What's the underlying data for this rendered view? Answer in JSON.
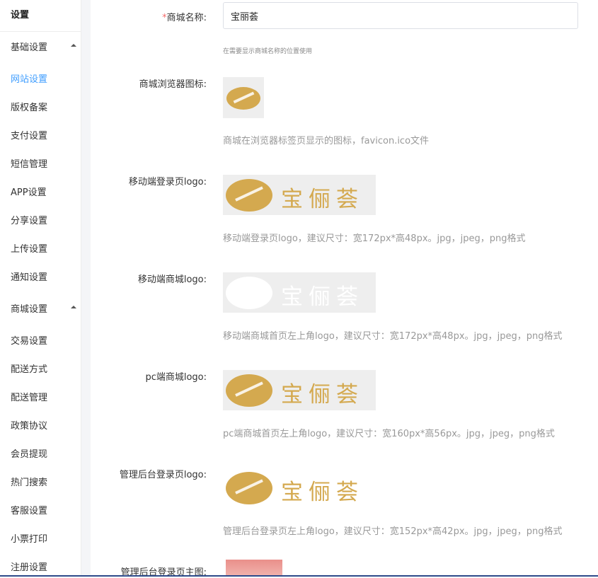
{
  "sidebar": {
    "title": "设置",
    "group_basic": "基础设置",
    "basic_items": [
      "网站设置",
      "版权备案",
      "支付设置",
      "短信管理",
      "APP设置",
      "分享设置",
      "上传设置",
      "通知设置"
    ],
    "group_mall": "商城设置",
    "mall_items": [
      "交易设置",
      "配送方式",
      "配送管理",
      "政策协议",
      "会员提现",
      "热门搜索",
      "客服设置",
      "小票打印",
      "注册设置"
    ],
    "active_item": "网站设置"
  },
  "form": {
    "mall_name": {
      "required_mark": "*",
      "label": "商城名称:",
      "value": "宝丽荟",
      "tip": "在需要显示商城名称的位置使用"
    },
    "favicon": {
      "label": "商城浏览器图标:",
      "tip": "商城在浏览器标签页显示的图标，favicon.ico文件"
    },
    "mobile_login_logo": {
      "label": "移动端登录页logo:",
      "logo_text": "宝俪荟",
      "tip": "移动端登录页logo，建议尺寸：宽172px*高48px。jpg，jpeg，png格式"
    },
    "mobile_mall_logo": {
      "label": "移动端商城logo:",
      "logo_text": "宝俪荟",
      "tip": "移动端商城首页左上角logo，建议尺寸：宽172px*高48px。jpg，jpeg，png格式"
    },
    "pc_mall_logo": {
      "label": "pc端商城logo:",
      "logo_text": "宝俪荟",
      "tip": "pc端商城首页左上角logo，建议尺寸：宽160px*高56px。jpg，jpeg，png格式"
    },
    "admin_login_logo": {
      "label": "管理后台登录页logo:",
      "logo_text": "宝俪荟",
      "tip": "管理后台登录页左上角logo，建议尺寸：宽152px*高42px。jpg，jpeg，png格式"
    },
    "admin_login_main_image": {
      "label": "管理后台登录页主图:"
    }
  },
  "colors": {
    "brand_gold": "#d4a94f",
    "brand_faded": "#ffffff",
    "active_blue": "#409eff",
    "required_red": "#f56c6c"
  }
}
